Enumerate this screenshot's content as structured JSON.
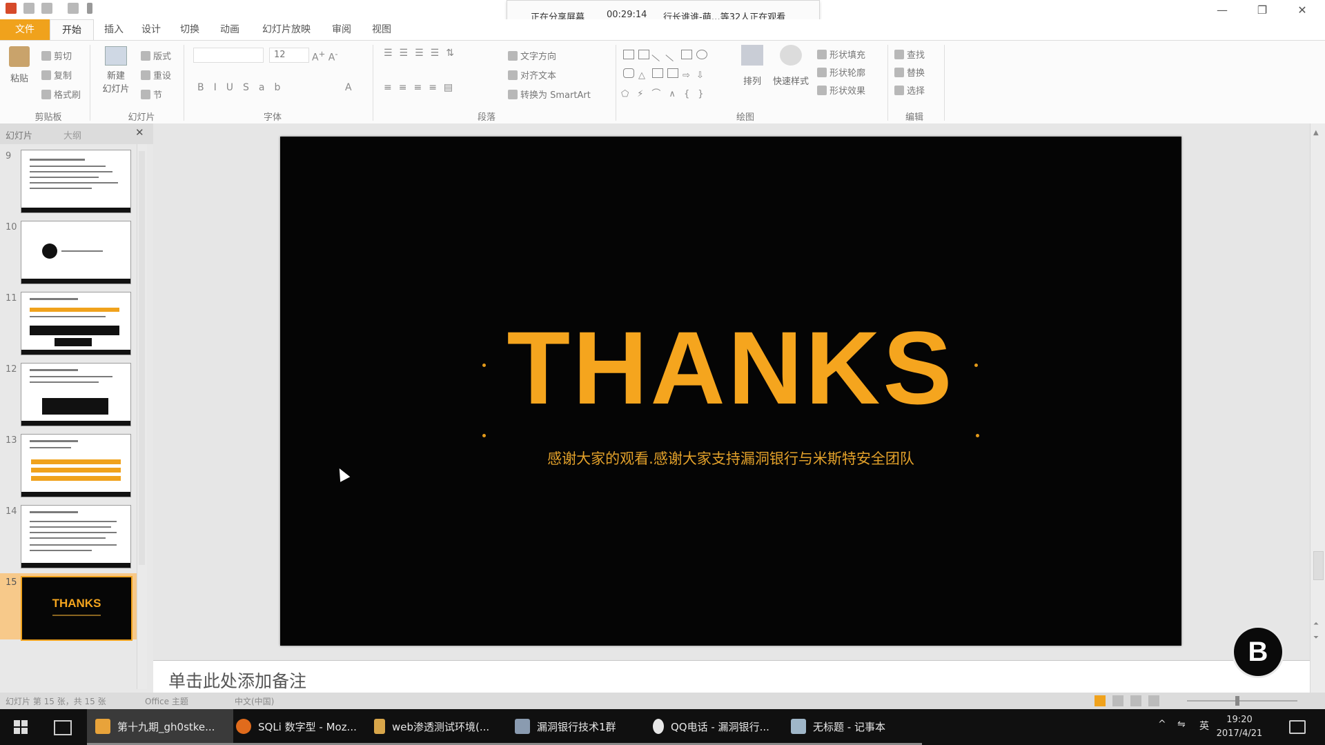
{
  "sharebar": {
    "status": "正在分享屏幕",
    "time": "00:29:14",
    "viewers": "行长谁谁-萌…等32人正在观看"
  },
  "ribbon": {
    "tabs": [
      "文件",
      "开始",
      "插入",
      "设计",
      "切换",
      "动画",
      "幻灯片放映",
      "审阅",
      "视图"
    ],
    "clipboard": {
      "paste": "粘贴",
      "cut": "剪切",
      "copy": "复制",
      "format_painter": "格式刷",
      "label": "剪贴板"
    },
    "slides": {
      "new_slide": "新建",
      "new_slide2": "幻灯片",
      "layout": "版式",
      "reset": "重设",
      "section": "节",
      "label": "幻灯片"
    },
    "font": {
      "size": "12",
      "label": "字体"
    },
    "paragraph": {
      "text_direction": "文字方向",
      "align_text": "对齐文本",
      "convert_smartart": "转换为 SmartArt",
      "label": "段落"
    },
    "drawing": {
      "arrange": "排列",
      "quick_styles": "快速样式",
      "shape_fill": "形状填充",
      "shape_outline": "形状轮廓",
      "shape_effects": "形状效果",
      "label": "绘图"
    },
    "editing": {
      "find": "查找",
      "replace": "替换",
      "select": "选择",
      "label": "编辑"
    }
  },
  "panel": {
    "tab_slides": "幻灯片",
    "tab_outline": "大纲",
    "slide_numbers": [
      "9",
      "10",
      "11",
      "12",
      "13",
      "14",
      "15"
    ],
    "thumb15_text": "THANKS"
  },
  "slide": {
    "title": "THANKS",
    "subtitle": "感谢大家的观看.感谢大家支持漏洞银行与米斯特安全团队"
  },
  "notes": {
    "placeholder": "单击此处添加备注"
  },
  "statusbar": {
    "slide_info": "幻灯片 第 15 张，共 15 张",
    "theme": "Office 主题",
    "language": "中文(中国)"
  },
  "taskbar": {
    "items": [
      {
        "label": "第十九期_gh0stke...",
        "color": "#e8a33a"
      },
      {
        "label": "SQLi 数字型 - Moz...",
        "color": "#e06b1c"
      },
      {
        "label": "web渗透测试环境(...",
        "color": "#d8a64a"
      },
      {
        "label": "漏洞银行技术1群",
        "color": "#8a9bb0"
      },
      {
        "label": "QQ电话 - 漏洞银行...",
        "color": "#e7e7e7"
      },
      {
        "label": "无标题 - 记事本",
        "color": "#9fb6c8"
      }
    ],
    "ime": "英",
    "time": "19:20",
    "date": "2017/4/21"
  },
  "badge": "B"
}
